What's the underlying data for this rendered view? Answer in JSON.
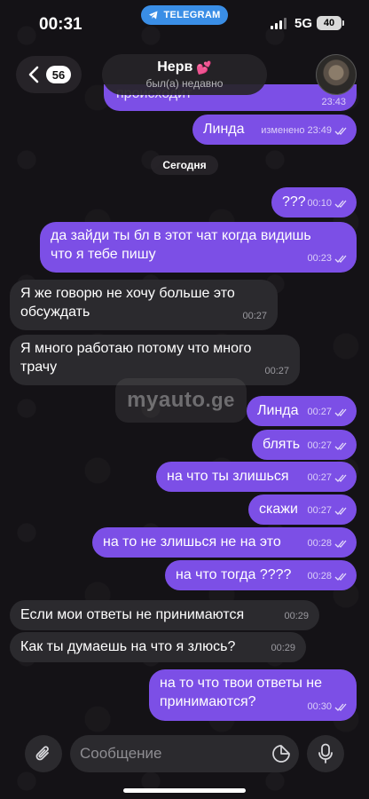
{
  "status_bar": {
    "time": "00:31",
    "app_pill": "TELEGRAM",
    "network": "5G",
    "battery": "40"
  },
  "header": {
    "back_count": "56",
    "contact_name": "Нерв",
    "contact_emoji": "💕",
    "contact_status": "был(а) недавно"
  },
  "partial_top": {
    "text": "происходит",
    "time": "23:43"
  },
  "date_separator": "Сегодня",
  "messages": [
    {
      "dir": "out",
      "text": "Линда",
      "edited": "изменено",
      "time": "23:49"
    },
    {
      "dir": "out",
      "text": "???",
      "time": "00:10"
    },
    {
      "dir": "out",
      "line1": "да зайди ты бл в этот чат когда видишь",
      "line2": "что я тебе пишу",
      "time": "00:23"
    },
    {
      "dir": "in",
      "line1": "Я же говорю не хочу больше это",
      "line2": "обсуждать",
      "time": "00:27"
    },
    {
      "dir": "in",
      "line1": "Я много работаю потому что много",
      "line2": "трачу",
      "time": "00:27"
    },
    {
      "dir": "out",
      "text": "Линда",
      "time": "00:27"
    },
    {
      "dir": "out",
      "text": "блять",
      "time": "00:27"
    },
    {
      "dir": "out",
      "text": "на что ты злишься",
      "time": "00:27"
    },
    {
      "dir": "out",
      "text": "скажи",
      "time": "00:27"
    },
    {
      "dir": "out",
      "text": "на то не злишься не на это",
      "time": "00:28"
    },
    {
      "dir": "out",
      "text": "на что тогда ????",
      "time": "00:28"
    },
    {
      "dir": "in",
      "text": "Если мои ответы не принимаются",
      "time": "00:29"
    },
    {
      "dir": "in",
      "text": "Как ты думаешь на что я злюсь?",
      "time": "00:29"
    },
    {
      "dir": "out",
      "line1": "на то что твои ответы не",
      "line2": "принимаются?",
      "time": "00:30"
    }
  ],
  "watermark": {
    "main": "myauto",
    "suffix": ".ge"
  },
  "composer": {
    "placeholder": "Сообщение"
  },
  "colors": {
    "outgoing": "#7c4fe6",
    "incoming": "#2b2a2e",
    "background": "#141216",
    "app_pill": "#3a8ee6"
  },
  "icons": {
    "back": "chevron-left-icon",
    "attach": "paperclip-icon",
    "sticker": "sticker-icon",
    "mic": "microphone-icon",
    "read": "double-check-icon"
  }
}
